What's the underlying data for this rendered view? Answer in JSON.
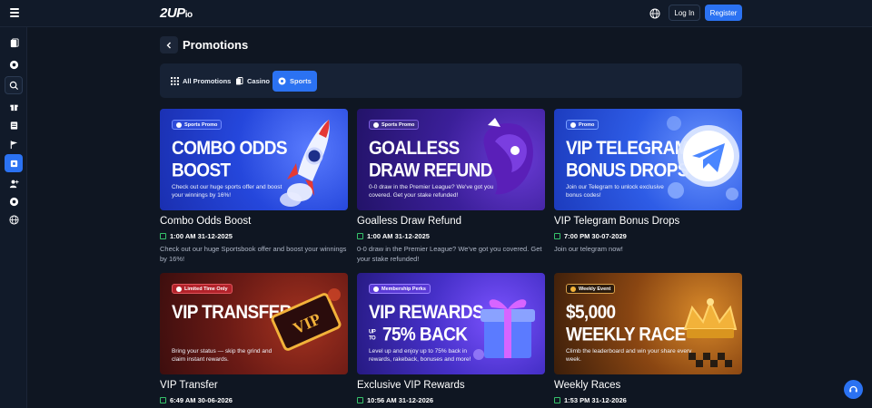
{
  "header": {
    "logo_main": "2UP",
    "logo_suffix": "io",
    "login_label": "Log In",
    "register_label": "Register"
  },
  "page": {
    "title": "Promotions"
  },
  "tabs": [
    {
      "label": "All Promotions",
      "icon": "grid-icon",
      "active": false
    },
    {
      "label": "Casino",
      "icon": "cards-icon",
      "active": false
    },
    {
      "label": "Sports",
      "icon": "ball-icon",
      "active": true
    }
  ],
  "promos": [
    {
      "badge": "Sports Promo",
      "banner_title_1": "Combo Odds",
      "banner_title_2": "Boost",
      "banner_desc": "Check out our huge sports offer and boost your winnings by 16%!",
      "title": "Combo Odds Boost",
      "date": "1:00 AM 31-12-2025",
      "description": "Check out our huge Sportsbook offer and boost your winnings by 16%!",
      "colors": {
        "bg1": "#1f3fcf",
        "bg2": "#3a5cf0",
        "badge": "#2d4ad8"
      }
    },
    {
      "badge": "Sports Promo",
      "banner_title_1": "Goalless",
      "banner_title_2": "Draw Refund",
      "banner_desc": "0-0 draw in the Premier League? We've got you covered. Get your stake refunded!",
      "title": "Goalless Draw Refund",
      "date": "1:00 AM 31-12-2025",
      "description": "0-0 draw in the Premier League? We've got you covered. Get your stake refunded!",
      "colors": {
        "bg1": "#2a1a6e",
        "bg2": "#4a2fa6",
        "badge": "#3c2a8c"
      }
    },
    {
      "badge": "Promo",
      "banner_title_1": "VIP Telegram",
      "banner_title_2": "Bonus Drops",
      "banner_desc": "Join our Telegram to unlock exclusive bonus codes!",
      "title": "VIP Telegram Bonus Drops",
      "date": "7:00 PM 30-07-2029",
      "description": "Join our telegram now!",
      "colors": {
        "bg1": "#1f43c9",
        "bg2": "#3d6cf2",
        "badge": "#2a4fd2"
      }
    },
    {
      "badge": "Limited Time Only",
      "banner_title_1": "VIP Transfer",
      "banner_title_2": "",
      "banner_desc": "Bring your status — skip the grind and claim instant rewards.",
      "title": "VIP Transfer",
      "date": "6:49 AM 30-06-2026",
      "description": "",
      "colors": {
        "bg1": "#5a1414",
        "bg2": "#8c2a1c",
        "badge": "#b3222a"
      }
    },
    {
      "badge": "Membership Perks",
      "banner_title_1": "VIP Rewards",
      "banner_title_2": "75% Back",
      "banner_small": "UP TO",
      "banner_desc": "Level up and enjoy up to 75% back in rewards, rakeback, bonuses and more!",
      "title": "Exclusive VIP Rewards",
      "date": "10:56 AM 31-12-2026",
      "description": "",
      "colors": {
        "bg1": "#25197a",
        "bg2": "#4a2fc4",
        "badge": "#5a3ad6"
      }
    },
    {
      "badge": "Weekly Event",
      "banner_title_1": "$5,000",
      "banner_title_2": "Weekly Race",
      "banner_desc": "Climb the leaderboard and win your share every week.",
      "title": "Weekly Races",
      "date": "1:53 PM 31-12-2026",
      "description": "",
      "colors": {
        "bg1": "#4a2a10",
        "bg2": "#a85a18",
        "badge": "#2a1a0c"
      }
    }
  ]
}
